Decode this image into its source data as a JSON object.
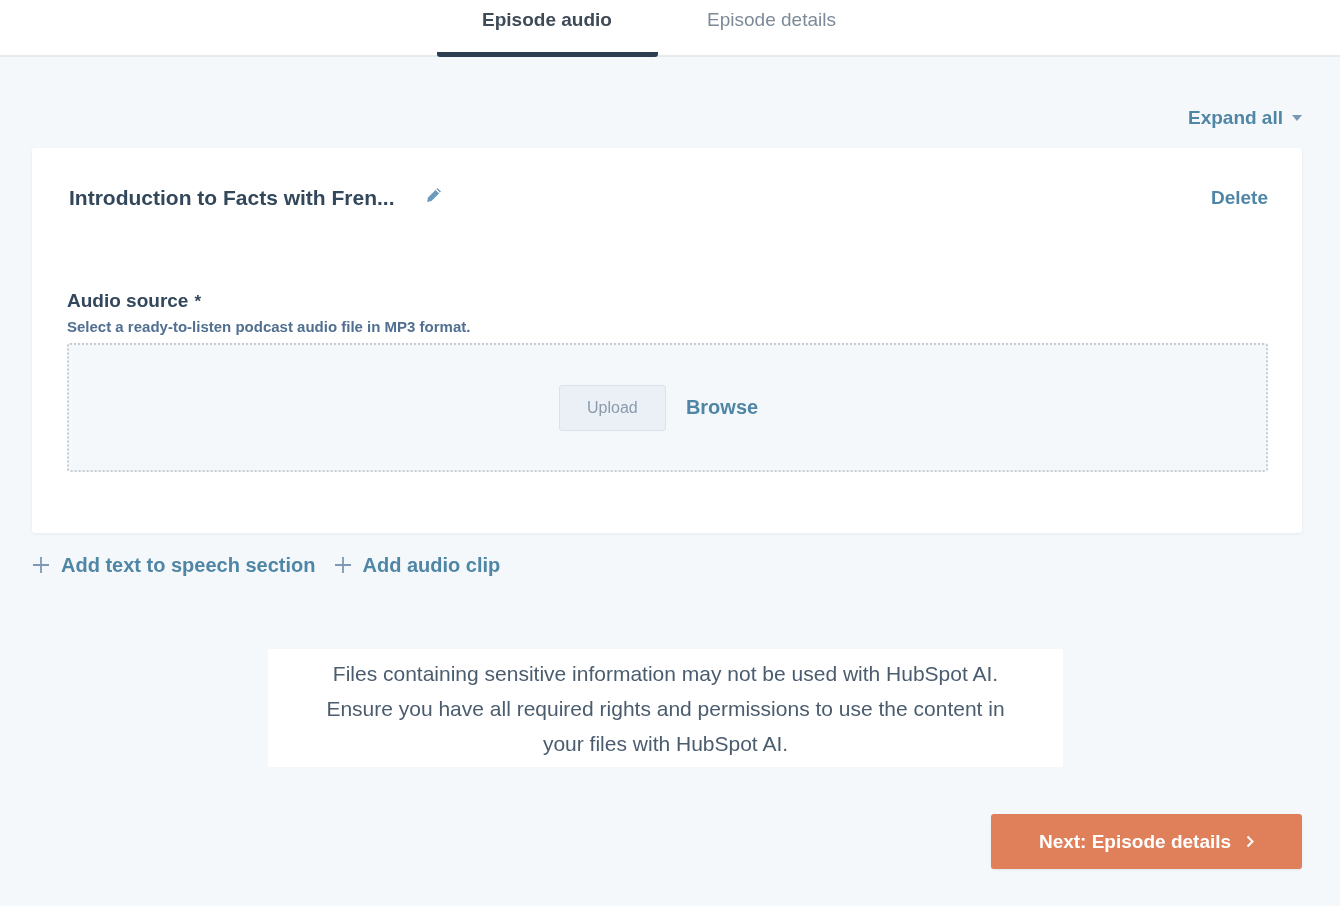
{
  "tabs": [
    {
      "label": "Episode audio",
      "selected": true
    },
    {
      "label": "Episode details",
      "selected": false
    }
  ],
  "expand_all": {
    "label": "Expand all"
  },
  "section": {
    "title": "Introduction to Facts with Fren...",
    "delete_label": "Delete",
    "audio_source": {
      "label": "Audio source",
      "required_mark": "*",
      "help": "Select a ready-to-listen podcast audio file in MP3 format.",
      "upload_button": {
        "label": "Upload",
        "disabled": true
      },
      "browse_link": "Browse"
    }
  },
  "add_actions": [
    {
      "label": "Add text to speech section"
    },
    {
      "label": "Add audio clip"
    }
  ],
  "notice": "Files containing sensitive information may not be used with HubSpot AI. Ensure you have all required rights and permissions to use the content in your files with HubSpot AI.",
  "next_button": {
    "label": "Next: Episode details"
  }
}
